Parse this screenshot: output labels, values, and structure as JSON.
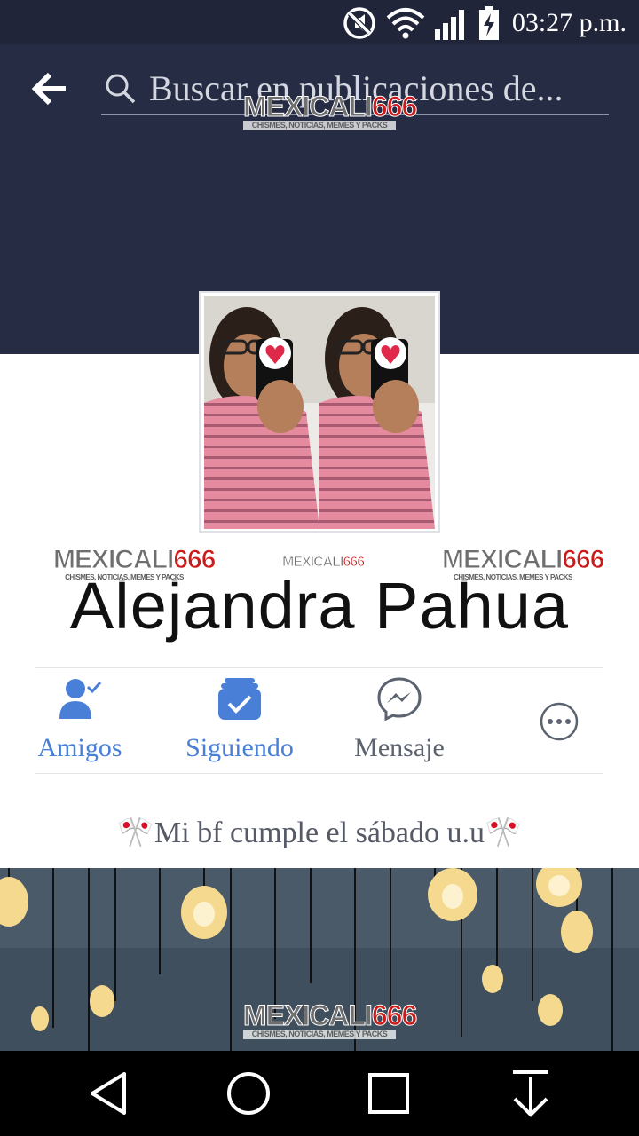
{
  "status_bar": {
    "time": "03:27 p.m.",
    "icons": [
      "mute-icon",
      "wifi-icon",
      "signal-icon",
      "battery-charging-icon"
    ]
  },
  "header": {
    "back_icon": "back-arrow-icon",
    "search_icon": "search-icon",
    "search_placeholder": "Buscar en publicaciones de..."
  },
  "watermark": {
    "brand_left": "MEXICALI",
    "brand_right": "666",
    "tagline": "CHISMES, NOTICIAS, MEMES Y PACKS"
  },
  "profile": {
    "name": "Alejandra Pahua",
    "bio": "🎌Mi bf cumple el sábado u.u🎌"
  },
  "actions": [
    {
      "label": "Amigos",
      "icon": "friends-check-icon",
      "color": "#4a7fd8"
    },
    {
      "label": "Siguiendo",
      "icon": "following-icon",
      "color": "#4a7fd8"
    },
    {
      "label": "Mensaje",
      "icon": "messenger-icon",
      "color": "#5b6270"
    },
    {
      "label": "",
      "icon": "more-options-icon",
      "color": "#5b6270"
    }
  ],
  "nav_bar": {
    "icons": [
      "back-triangle-icon",
      "home-circle-icon",
      "recents-square-icon",
      "download-arrow-icon"
    ]
  },
  "colors": {
    "header_bg": "#262c44",
    "accent_blue": "#4a7fd8"
  }
}
